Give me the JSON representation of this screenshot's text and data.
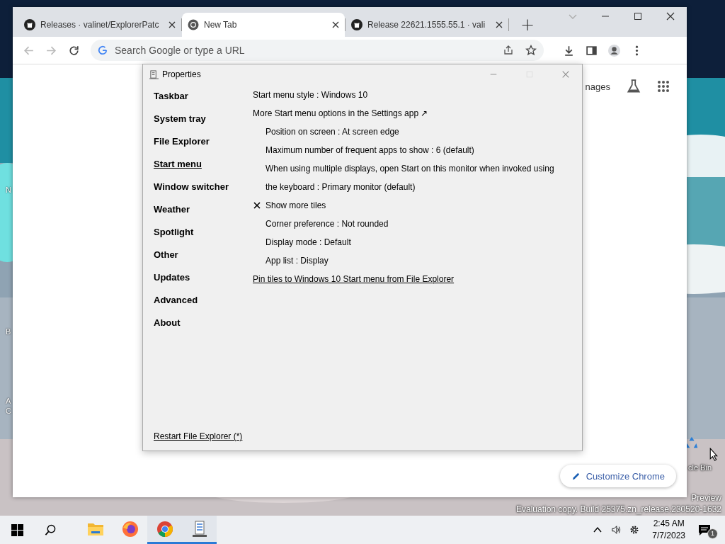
{
  "desktop": {
    "left_icon_labels": [
      "N",
      "B",
      "A",
      "C"
    ],
    "right_icon_label": "cle Bin",
    "watermark": [
      "Preview",
      "Evaluation copy. Build 25375.zn_release.230520-1632"
    ]
  },
  "browser": {
    "tabs": [
      {
        "title": "Releases · valinet/ExplorerPatc",
        "selected": false,
        "kind": "site"
      },
      {
        "title": "New Tab",
        "selected": true,
        "kind": "new-tab"
      },
      {
        "title": "Release 22621.1555.55.1 · vali",
        "selected": false,
        "kind": "site"
      }
    ],
    "new_tab": "+",
    "omnibox": {
      "placeholder": "Search Google or type a URL"
    },
    "page": {
      "images_link": "nages",
      "customize_button": "Customize Chrome"
    }
  },
  "properties": {
    "title": "Properties",
    "sections": [
      {
        "label": "Taskbar",
        "selected": false
      },
      {
        "label": "System tray",
        "selected": false
      },
      {
        "label": "File Explorer",
        "selected": false
      },
      {
        "label": "Start menu",
        "selected": true
      },
      {
        "label": "Window switcher",
        "selected": false
      },
      {
        "label": "Weather",
        "selected": false
      },
      {
        "label": "Spotlight",
        "selected": false
      },
      {
        "label": "Other",
        "selected": false
      },
      {
        "label": "Updates",
        "selected": false
      },
      {
        "label": "Advanced",
        "selected": false
      },
      {
        "label": "About",
        "selected": false
      }
    ],
    "settings": [
      {
        "kind": "value",
        "text": "Start menu style : Windows 10"
      },
      {
        "kind": "external",
        "text": "More Start menu options in the Settings app ↗",
        "children": [
          {
            "kind": "value",
            "text": "Position on screen : At screen edge"
          },
          {
            "kind": "value",
            "text": "Maximum number of frequent apps to show : 6 (default)"
          },
          {
            "kind": "value",
            "text": "When using multiple displays, open Start on this monitor when invoked using the keyboard : Primary monitor (default)"
          },
          {
            "kind": "check",
            "checked": true,
            "text": "Show more tiles"
          },
          {
            "kind": "value",
            "text": "Corner preference : Not rounded"
          },
          {
            "kind": "value",
            "text": "Display mode : Default"
          },
          {
            "kind": "value",
            "text": "App list : Display"
          }
        ]
      },
      {
        "kind": "link",
        "text": "Pin tiles to Windows 10 Start menu from File Explorer"
      }
    ],
    "footer_link": "Restart File Explorer (*)"
  },
  "taskbar": {
    "apps": [
      {
        "kind": "explorer",
        "running": false
      },
      {
        "kind": "firefox",
        "running": false
      },
      {
        "kind": "chrome",
        "running": true
      },
      {
        "kind": "properties",
        "running": true
      }
    ],
    "time": "2:45 AM",
    "date": "7/7/2023",
    "notification_count": "1"
  }
}
